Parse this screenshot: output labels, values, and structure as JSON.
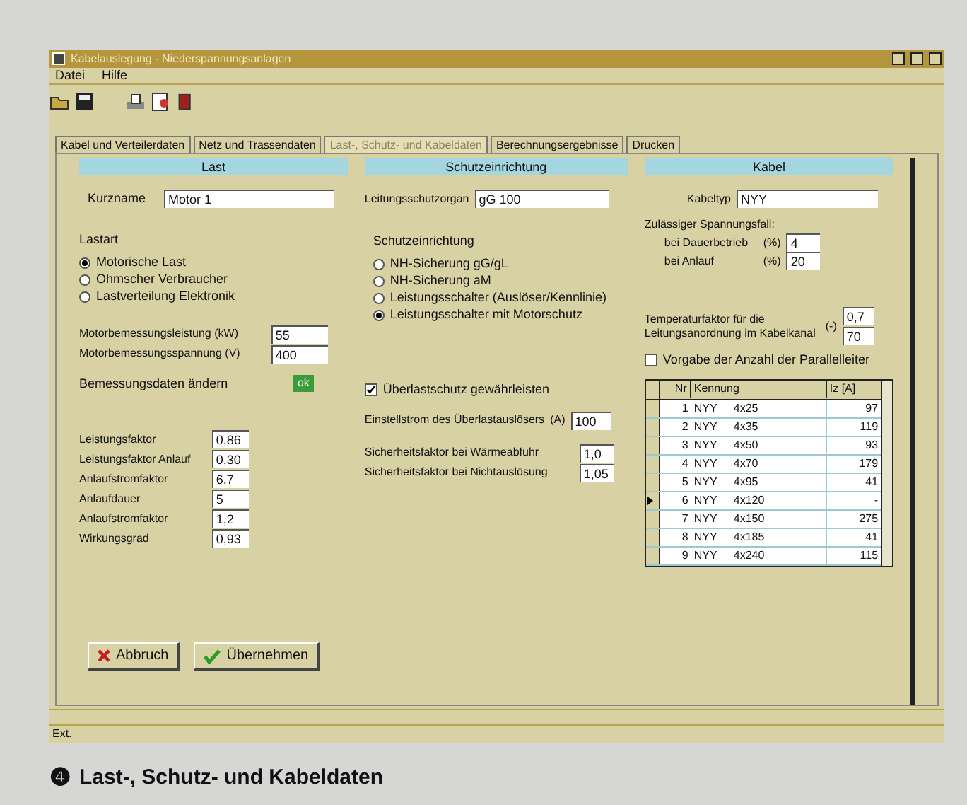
{
  "window": {
    "title": "Kabelauslegung - Niederspannungsanlagen"
  },
  "menu": [
    "Datei",
    "Hilfe"
  ],
  "tabs": [
    {
      "label": "Kabel und Verteilerdaten",
      "selected": false
    },
    {
      "label": "Netz und Trassendaten",
      "selected": false
    },
    {
      "label": "Last-, Schutz- und Kabeldaten",
      "selected": true
    },
    {
      "label": "Berechnungsergebnisse",
      "selected": false
    },
    {
      "label": "Drucken",
      "selected": false
    }
  ],
  "last": {
    "header": "Last",
    "name_label": "Kurzname",
    "name_value": "Motor 1",
    "group_label": "Lastart",
    "radios": [
      {
        "label": "Motorische Last",
        "selected": true
      },
      {
        "label": "Ohmscher Verbraucher",
        "selected": false
      },
      {
        "label": "Lastverteilung Elektronik",
        "selected": false
      }
    ],
    "motor_fields": [
      {
        "label": "Motorbemessungsleistung (kW)",
        "value": "55"
      },
      {
        "label": "Motorbemessungsspannung (V)",
        "value": "400"
      }
    ],
    "change_label": "Bemessungsdaten ändern",
    "ok_button": "ok",
    "factors": [
      {
        "label": "Leistungsfaktor",
        "value": "0,86"
      },
      {
        "label": "Leistungsfaktor Anlauf",
        "value": "0,30"
      },
      {
        "label": "Anlaufstromfaktor",
        "value": "6,7"
      },
      {
        "label": "Anlaufdauer",
        "value": "5"
      },
      {
        "label": "Anlaufstromfaktor",
        "value": "1,2"
      },
      {
        "label": "Wirkungsgrad",
        "value": "0,93"
      }
    ]
  },
  "schutz": {
    "header": "Schutzeinrichtung",
    "organ_label": "Leitungsschutzorgan",
    "organ_value": "gG 100",
    "group_label": "Schutzeinrichtung",
    "radios": [
      {
        "label": "NH-Sicherung gG/gL",
        "selected": false
      },
      {
        "label": "NH-Sicherung aM",
        "selected": false
      },
      {
        "label": "Leistungsschalter (Auslöser/Kennlinie)",
        "selected": false
      },
      {
        "label": "Leistungsschalter mit Motorschutz",
        "selected": true
      }
    ],
    "overload": {
      "label": "Überlastschutz gewährleisten",
      "checked": true
    },
    "current": {
      "label": "Einstellstrom des Überlastauslösers",
      "unit": "(A)",
      "value": "100"
    },
    "safety": [
      {
        "label": "Sicherheitsfaktor bei Wärmeabfuhr",
        "value": "1,0"
      },
      {
        "label": "Sicherheitsfaktor bei Nichtauslösung",
        "value": "1,05"
      }
    ]
  },
  "kabel": {
    "header": "Kabel",
    "type_label": "Kabeltyp",
    "type_value": "NYY",
    "drop_label": "Zulässiger Spannungsfall:",
    "drop_fields": [
      {
        "label": "bei Dauerbetrieb",
        "unit": "(%)",
        "value": "4"
      },
      {
        "label": "bei Anlauf",
        "unit": "(%)",
        "value": "20"
      }
    ],
    "temp_label": "Temperaturfaktor für die Leitungsanordnung im Kabelkanal",
    "temp_unit": "(-)",
    "temp_values": [
      "0,7",
      "70"
    ],
    "parallel": {
      "label": "Vorgabe der Anzahl der Parallelleiter",
      "checked": false
    },
    "table": {
      "columns": [
        "Nr",
        "Kennung",
        "Iz [A]"
      ],
      "rows": [
        {
          "cells": [
            "1",
            "NYY",
            "4x25"
          ],
          "value": "97",
          "selected": false
        },
        {
          "cells": [
            "2",
            "NYY",
            "4x35"
          ],
          "value": "119",
          "selected": false
        },
        {
          "cells": [
            "3",
            "NYY",
            "4x50"
          ],
          "value": "93",
          "selected": false
        },
        {
          "cells": [
            "4",
            "NYY",
            "4x70"
          ],
          "value": "179",
          "selected": false
        },
        {
          "cells": [
            "5",
            "NYY",
            "4x95"
          ],
          "value": "41",
          "selected": false
        },
        {
          "cells": [
            "6",
            "NYY",
            "4x120"
          ],
          "value": "-",
          "selected": true
        },
        {
          "cells": [
            "7",
            "NYY",
            "4x150"
          ],
          "value": "275",
          "selected": false
        },
        {
          "cells": [
            "8",
            "NYY",
            "4x185"
          ],
          "value": "41",
          "selected": false
        },
        {
          "cells": [
            "9",
            "NYY",
            "4x240"
          ],
          "value": "115",
          "selected": false
        }
      ]
    }
  },
  "buttons": [
    {
      "kind": "cancel",
      "label": "Abbruch"
    },
    {
      "kind": "apply",
      "label": "Übernehmen"
    }
  ],
  "status_bar": "Ext.",
  "caption": {
    "number": "❹",
    "text": "Last-, Schutz- und Kabeldaten"
  }
}
